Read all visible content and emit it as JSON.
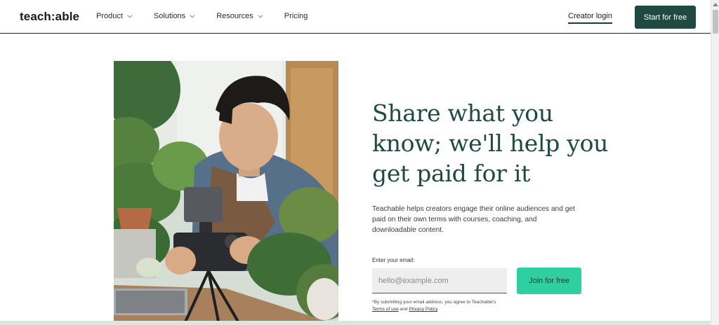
{
  "header": {
    "logo": "teach:able",
    "nav": [
      {
        "label": "Product",
        "has_dropdown": true
      },
      {
        "label": "Solutions",
        "has_dropdown": true
      },
      {
        "label": "Resources",
        "has_dropdown": true
      },
      {
        "label": "Pricing",
        "has_dropdown": false
      }
    ],
    "creator_login": "Creator login",
    "start_button": "Start for free"
  },
  "hero": {
    "image_alt_icon": "creator-filming-plants-photo",
    "headline": "Share what you know; we'll help you get paid for it",
    "subtext": "Teachable helps creators engage their online audiences and get paid on their own terms with courses, coaching, and downloadable content.",
    "email_label": "Enter your email:",
    "email_placeholder": "hello@example.com",
    "join_button": "Join for free",
    "disclaimer_prefix": "*By submitting your email address, you agree to Teachable's",
    "terms_link": "Terms of use",
    "disclaimer_and": "and",
    "privacy_link": "Privacy Policy",
    "disclaimer_suffix": "."
  },
  "colors": {
    "brand_dark": "#1f4a41",
    "accent_green": "#2fcfa1",
    "band": "#d9e8df"
  }
}
